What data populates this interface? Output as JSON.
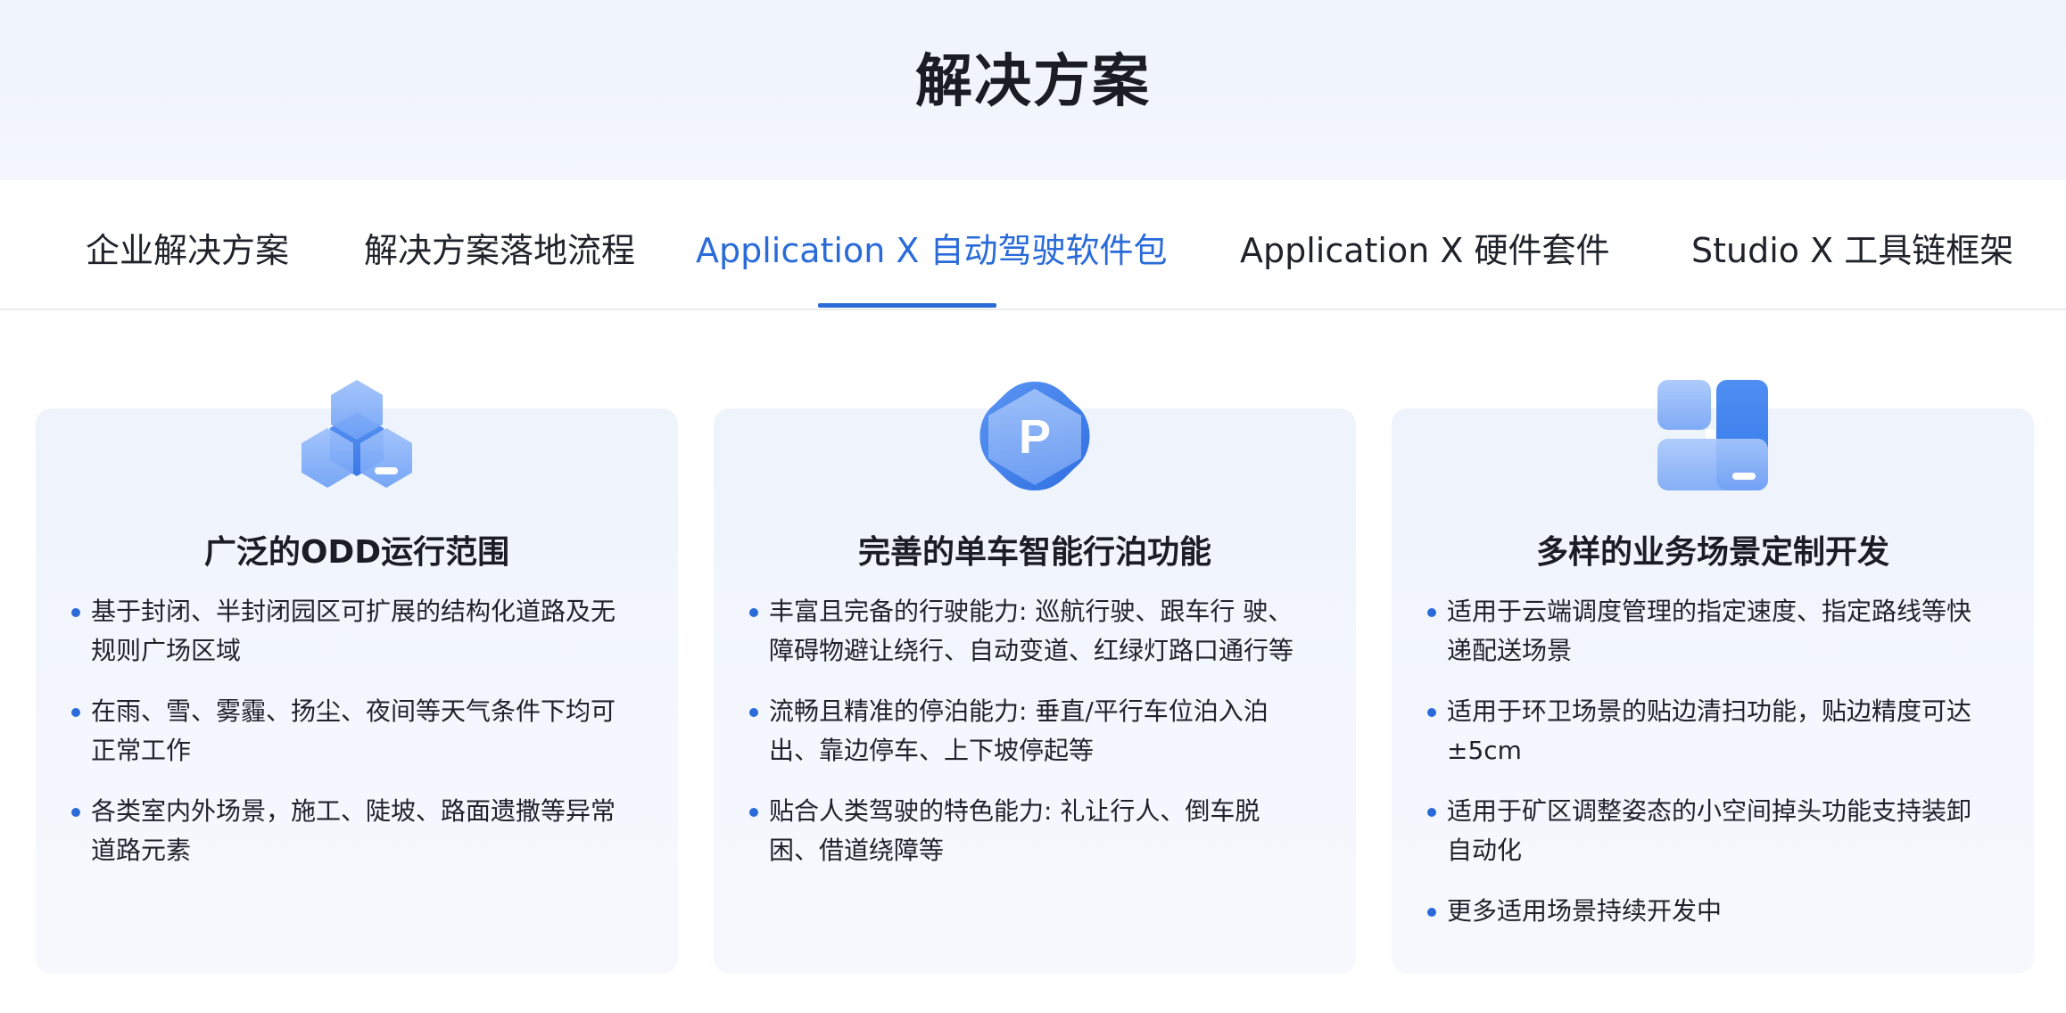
{
  "page": {
    "title": "解决方案"
  },
  "tabs": [
    {
      "label": "企业解决方案"
    },
    {
      "label": "解决方案落地流程"
    },
    {
      "label": "Application X 自动驾驶软件包",
      "active": true
    },
    {
      "label": "Application X 硬件套件"
    },
    {
      "label": "Studio X 工具链框架"
    }
  ],
  "colors": {
    "accent": "#2a6bd9",
    "card_bg": "#eef3fc",
    "text": "#1f2329"
  },
  "cards": [
    {
      "icon": "hexagon-cluster-icon",
      "title": "广泛的ODD运行范围",
      "bullets": [
        "基于封闭、半封闭园区可扩展的结构化道路及无规则广场区域",
        "在雨、雪、雾霾、扬尘、夜间等天气条件下均可正常工作",
        "各类室内外场景，施工、陡坡、路面遗撒等异常道路元素"
      ]
    },
    {
      "icon": "parking-p-icon",
      "title": "完善的单车智能行泊功能",
      "icon_letter": "P",
      "bullets": [
        "丰富且完备的行驶能力: 巡航行驶、跟车行 驶、障碍物避让绕行、自动变道、红绿灯路口通行等",
        "流畅且精准的停泊能力: 垂直/平行车位泊入泊出、靠边停车、上下坡停起等",
        "贴合人类驾驶的特色能力: 礼让行人、倒车脱困、借道绕障等"
      ]
    },
    {
      "icon": "layout-blocks-icon",
      "title": "多样的业务场景定制开发",
      "bullets": [
        "适用于云端调度管理的指定速度、指定路线等快递配送场景",
        "适用于环卫场景的贴边清扫功能，贴边精度可达±5cm",
        "适用于矿区调整姿态的小空间掉头功能支持装卸自动化",
        "更多适用场景持续开发中"
      ]
    }
  ]
}
